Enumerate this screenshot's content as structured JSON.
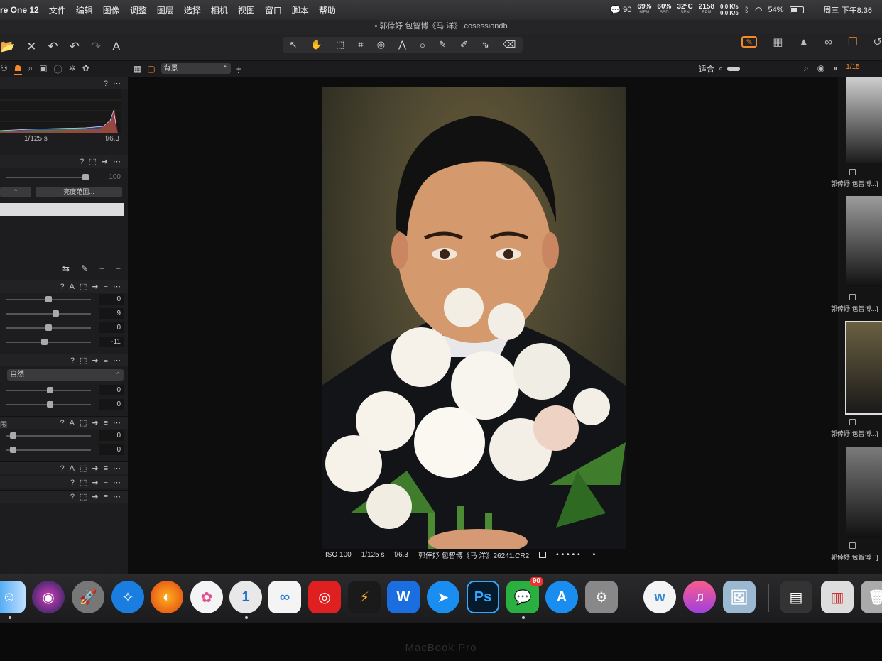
{
  "menubar": {
    "app_name": "re One 12",
    "items": [
      "文件",
      "编辑",
      "图像",
      "调整",
      "图层",
      "选择",
      "相机",
      "视图",
      "窗口",
      "脚本",
      "帮助"
    ],
    "status": {
      "notif_count": "90",
      "mem": {
        "value": "69%",
        "label": "MEM"
      },
      "ssd": {
        "value": "60%",
        "label": "SSD"
      },
      "sen": {
        "value": "32°C",
        "label": "SEN"
      },
      "rpm": {
        "value": "2158",
        "label": "RPM"
      },
      "net_up": "0.0 K/s",
      "net_down": "0.0 K/s",
      "battery": "54%",
      "clock": "周三 下午8:36"
    }
  },
  "titlebar": {
    "title": "郭倖妤 包智博《马 洋》.cosessiondb"
  },
  "toolbar": {
    "text_tool": "A",
    "center_tools": [
      "↖",
      "✋",
      "⬚",
      "⌗",
      "◎",
      "⋀",
      "○",
      "✎",
      "✐",
      "⇘",
      "⌫"
    ]
  },
  "subbar": {
    "layer_select": "背景",
    "fit_label": "适合",
    "count": "1/15"
  },
  "leftpanel": {
    "shutter": "1/125 s",
    "aperture": "f/6.3",
    "opacity_value": "100",
    "range_button": "亮度范围...",
    "group1_values": [
      "0",
      "9",
      "0",
      "-11"
    ],
    "group2_select": "自然",
    "group2_values": [
      "0",
      "0"
    ],
    "group3_label": "围",
    "group3_values": [
      "0",
      "0"
    ],
    "icon_A": "A",
    "icon_help": "?"
  },
  "photo_info": {
    "iso": "ISO 100",
    "shutter": "1/125 s",
    "aperture": "f/6.3",
    "filename": "郭倖妤 包智博《马 洋》26241.CR2"
  },
  "browser": {
    "thumb_label": "郭倖妤 包智博...]"
  },
  "dock": {
    "badge_wechat": "90",
    "items": [
      "finder",
      "siri",
      "launchpad",
      "safari",
      "firefox",
      "photos",
      "1password",
      "baidu",
      "netease-music",
      "clash",
      "wps",
      "dingtalk",
      "photoshop",
      "wechat",
      "app-store",
      "system-preferences",
      "wunderlist",
      "itunes",
      "preview",
      "stack",
      "notes",
      "trash"
    ]
  },
  "bezel": {
    "label": "MacBook Pro"
  },
  "colors": {
    "accent": "#f58a2a",
    "menubar": "#2f2f31",
    "panel": "#1d1d1f"
  }
}
